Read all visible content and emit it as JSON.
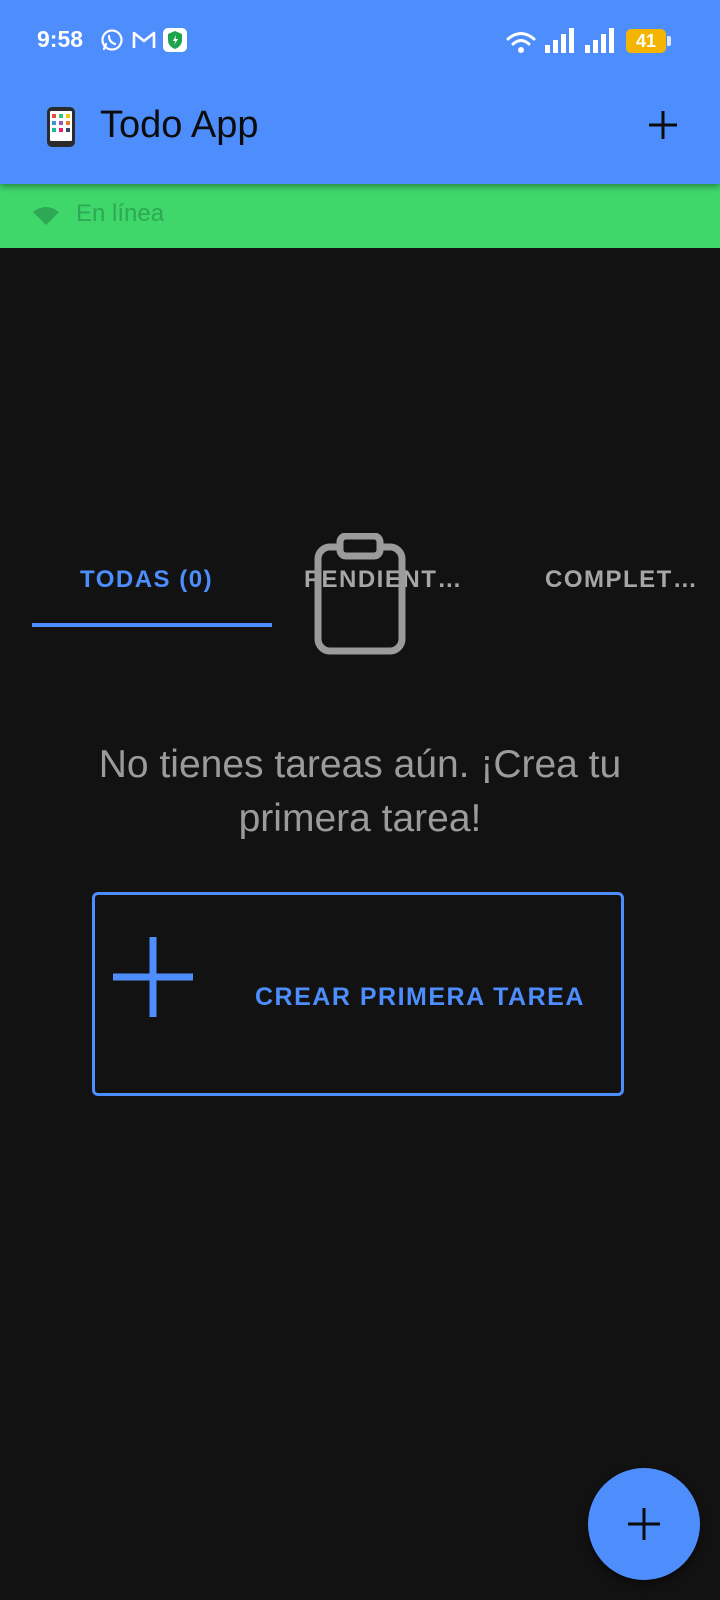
{
  "status_bar": {
    "time": "9:58",
    "battery_level": "41",
    "icons": [
      "whatsapp-icon",
      "gmail-icon",
      "security-shield-icon",
      "wifi-icon",
      "signal-icon",
      "signal-icon",
      "battery-icon"
    ]
  },
  "app_bar": {
    "title": "Todo App",
    "leading_icon": "mobile-phone-emoji",
    "action_icon": "add-icon"
  },
  "connection_banner": {
    "icon": "wifi-icon",
    "text": "En línea",
    "color": "#3fd76a"
  },
  "tabs": [
    {
      "label": "TODAS (0)",
      "active": true
    },
    {
      "label": "PENDIENT…",
      "active": false
    },
    {
      "label": "COMPLET…",
      "active": false
    }
  ],
  "empty_state": {
    "icon": "clipboard-icon",
    "message": "No tienes tareas aún. ¡Crea tu primera tarea!",
    "button_label": "CREAR PRIMERA TAREA",
    "button_icon": "add-icon"
  },
  "fab": {
    "icon": "add-icon"
  },
  "colors": {
    "primary": "#4d8dfc",
    "background": "#121212",
    "banner": "#3fd76a",
    "muted_text": "#9b9b9b"
  }
}
